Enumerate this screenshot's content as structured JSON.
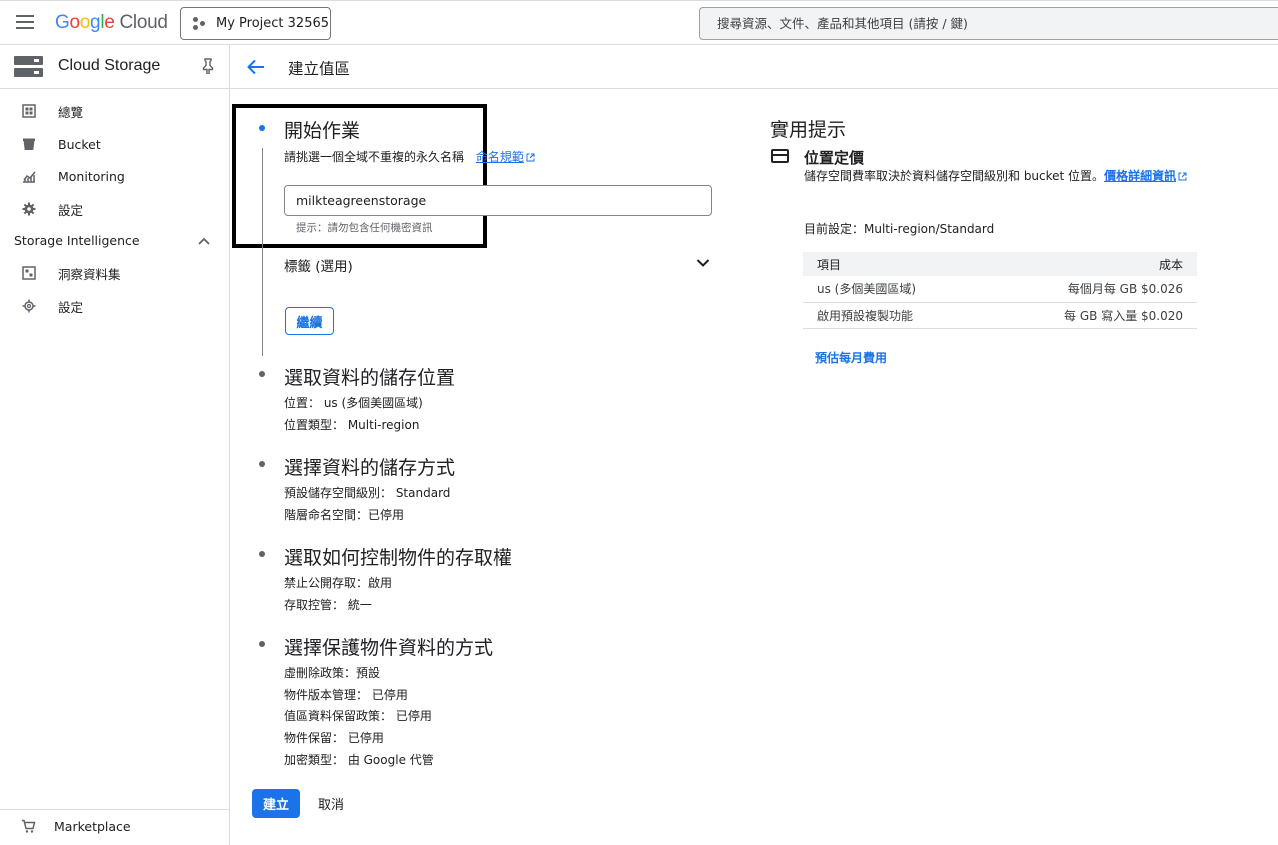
{
  "topbar": {
    "logo_google": [
      "G",
      "o",
      "o",
      "g",
      "l",
      "e"
    ],
    "logo_cloud": "Cloud",
    "project": "My Project 32565",
    "search_placeholder": "搜尋資源、文件、產品和其他項目 (請按 / 鍵)"
  },
  "sidebar": {
    "title": "Cloud Storage",
    "items": [
      {
        "label": "總覽",
        "icon": "overview-icon"
      },
      {
        "label": "Bucket",
        "icon": "bucket-icon"
      },
      {
        "label": "Monitoring",
        "icon": "monitoring-icon"
      },
      {
        "label": "設定",
        "icon": "settings-icon"
      }
    ],
    "section": "Storage Intelligence",
    "section_items": [
      {
        "label": "洞察資料集",
        "icon": "dataset-icon"
      },
      {
        "label": "設定",
        "icon": "settings-icon"
      }
    ],
    "bottom": "Marketplace"
  },
  "page": {
    "title": "建立值區"
  },
  "steps": {
    "start": {
      "title": "開始作業",
      "desc": "請挑選一個全域不重複的永久名稱",
      "naming_link": "命名規範",
      "name_value": "milkteagreenstorage",
      "hint": "提示：請勿包含任何機密資訊",
      "labels": "標籤 (選用)",
      "continue": "繼續"
    },
    "location": {
      "title": "選取資料的儲存位置",
      "line1": "位置： us (多個美國區域)",
      "line2": "位置類型： Multi-region"
    },
    "storage": {
      "title": "選擇資料的儲存方式",
      "line1": "預設儲存空間級別： Standard",
      "line2": "階層命名空間：已停用"
    },
    "access": {
      "title": "選取如何控制物件的存取權",
      "line1": "禁止公開存取：啟用",
      "line2": "存取控管： 統一"
    },
    "protection": {
      "title": "選擇保護物件資料的方式",
      "line1": "虛刪除政策：預設",
      "line2": "物件版本管理： 已停用",
      "line3": "值區資料保留政策： 已停用",
      "line4": "物件保留： 已停用",
      "line5": "加密類型： 由 Google 代管"
    },
    "create": "建立",
    "cancel": "取消"
  },
  "tips": {
    "title": "實用提示",
    "pricing_title": "位置定價",
    "pricing_desc": "儲存空間費率取決於資料儲存空間級別和 bucket 位置。",
    "pricing_link": "價格詳細資訊",
    "current": "目前設定：Multi-region/Standard",
    "table": {
      "headers": [
        "項目",
        "成本"
      ],
      "rows": [
        [
          "us (多個美國區域)",
          "每個月每 GB $0.026"
        ],
        [
          "啟用預設複製功能",
          "每 GB 寫入量 $0.020"
        ]
      ]
    },
    "estimate": "預估每月費用"
  },
  "colors": {
    "accent": "#1a73e8",
    "border": "#dadce0",
    "text": "#202124"
  }
}
